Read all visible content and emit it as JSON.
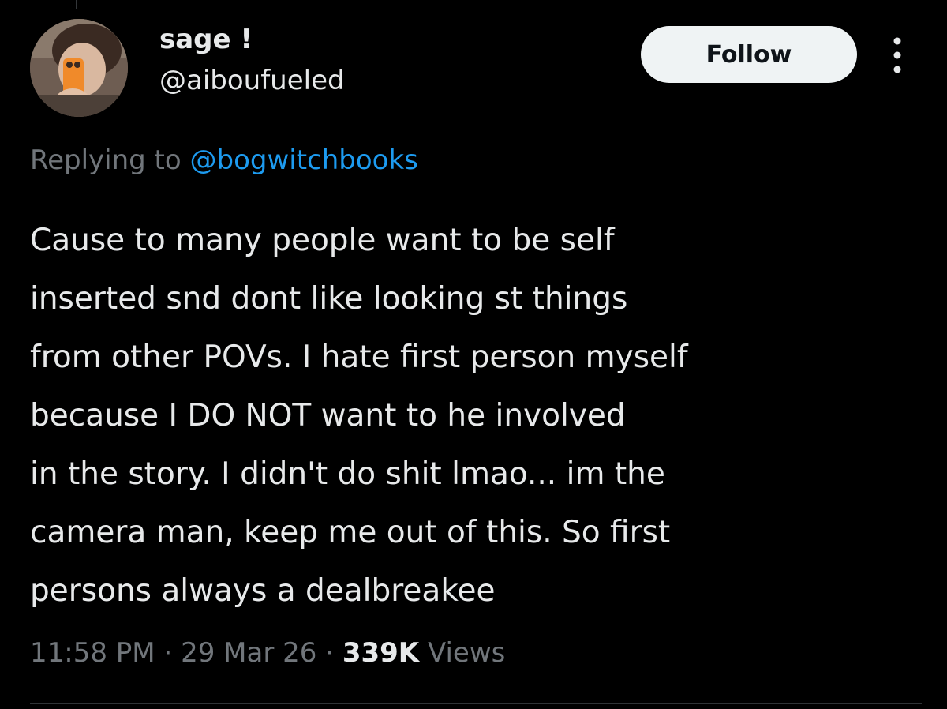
{
  "author": {
    "display_name": "sage !",
    "handle": "@aiboufueled"
  },
  "actions": {
    "follow_label": "Follow",
    "more_icon": "more-vertical-icon"
  },
  "reply": {
    "prefix": "Replying to",
    "target": "@bogwitchbooks"
  },
  "tweet": {
    "lines": [
      "Cause to many people want to be self",
      "inserted snd dont like looking st things",
      "from other POVs. I hate first person myself",
      "because I DO NOT want to he involved",
      "in the story. I didn't do shit lmao... im the",
      "camera man, keep me out of this. So first",
      "persons always a dealbreakee"
    ]
  },
  "meta": {
    "time": "11:58 PM",
    "separator": "·",
    "date": "29 Mar 26",
    "views_count": "339K",
    "views_label": "Views"
  },
  "colors": {
    "background": "#000000",
    "text_primary": "#e7e9ea",
    "text_secondary": "#71767b",
    "link": "#1d9bf0",
    "follow_bg": "#eff3f4",
    "follow_text": "#0f1419"
  }
}
